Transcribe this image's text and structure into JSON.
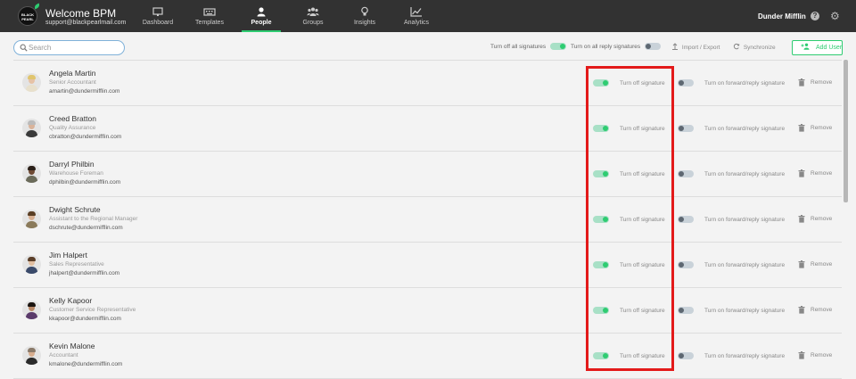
{
  "brand": {
    "logo_text": "BLACK PEARL",
    "title": "Welcome BPM",
    "subtitle": "support@blackpearlmail.com"
  },
  "nav": [
    {
      "label": "Dashboard",
      "icon": "monitor-icon",
      "active": false
    },
    {
      "label": "Templates",
      "icon": "keyboard-icon",
      "active": false
    },
    {
      "label": "People",
      "icon": "person-icon",
      "active": true
    },
    {
      "label": "Groups",
      "icon": "group-icon",
      "active": false
    },
    {
      "label": "Insights",
      "icon": "lightbulb-icon",
      "active": false
    },
    {
      "label": "Analytics",
      "icon": "line-chart-icon",
      "active": false
    }
  ],
  "org_name": "Dunder Mifflin",
  "toolbar": {
    "search_placeholder": "Search",
    "search_value": "",
    "turn_off_all_label": "Turn off all signatures",
    "turn_on_reply_label": "Turn on all reply signatures",
    "import_export_label": "Import / Export",
    "synchronize_label": "Synchronize",
    "add_user_label": "Add User"
  },
  "people": [
    {
      "name": "Angela Martin",
      "role": "Senior Accountant",
      "email": "amartin@dundermifflin.com",
      "sig_label": "Turn off signature",
      "fwd_label": "Turn on forward/reply signature",
      "remove_label": "Remove"
    },
    {
      "name": "Creed Bratton",
      "role": "Quality Assurance",
      "email": "cbratton@dundermifflin.com",
      "sig_label": "Turn off signature",
      "fwd_label": "Turn on forward/reply signature",
      "remove_label": "Remove"
    },
    {
      "name": "Darryl Philbin",
      "role": "Warehouse Foreman",
      "email": "dphilbin@dundermifflin.com",
      "sig_label": "Turn off signature",
      "fwd_label": "Turn on forward/reply signature",
      "remove_label": "Remove"
    },
    {
      "name": "Dwight Schrute",
      "role": "Assistant to the Regional Manager",
      "email": "dschrute@dundermifflin.com",
      "sig_label": "Turn off signature",
      "fwd_label": "Turn on forward/reply signature",
      "remove_label": "Remove"
    },
    {
      "name": "Jim Halpert",
      "role": "Sales Representative",
      "email": "jhalpert@dundermifflin.com",
      "sig_label": "Turn off signature",
      "fwd_label": "Turn on forward/reply signature",
      "remove_label": "Remove"
    },
    {
      "name": "Kelly Kapoor",
      "role": "Customer Service Representative",
      "email": "kkapoor@dundermifflin.com",
      "sig_label": "Turn off signature",
      "fwd_label": "Turn on forward/reply signature",
      "remove_label": "Remove"
    },
    {
      "name": "Kevin Malone",
      "role": "Accountant",
      "email": "kmalone@dundermifflin.com",
      "sig_label": "Turn off signature",
      "fwd_label": "Turn on forward/reply signature",
      "remove_label": "Remove"
    }
  ],
  "colors": {
    "accent": "#2ecc71",
    "topbar": "#323232",
    "highlight": "#e31a1a"
  }
}
